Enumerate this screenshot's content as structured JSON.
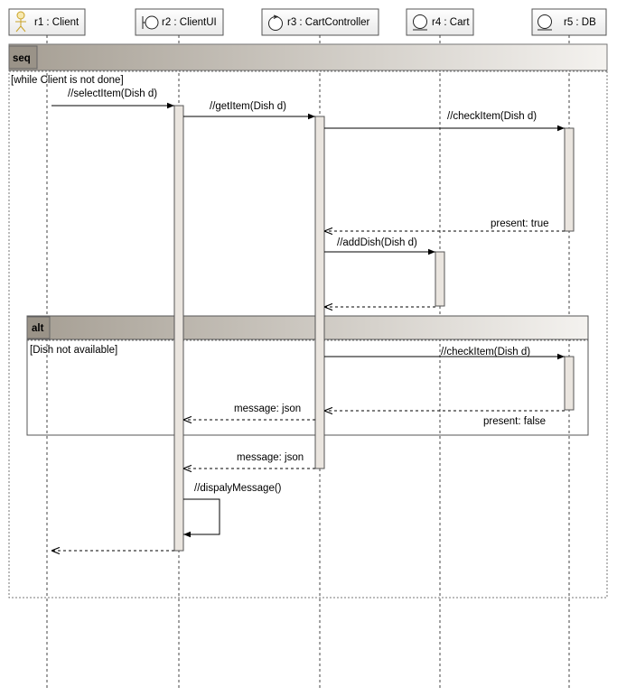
{
  "participants": [
    {
      "label": "r1 : Client",
      "icon": "actor-icon"
    },
    {
      "label": "r2 : ClientUI",
      "icon": "boundary-icon"
    },
    {
      "label": "r3 : CartController",
      "icon": "control-icon"
    },
    {
      "label": "r4 : Cart",
      "icon": "entity-icon"
    },
    {
      "label": "r5 : DB",
      "icon": "entity-icon"
    }
  ],
  "fragments": {
    "seq": {
      "operator": "seq",
      "guard": "[while Client is not done]"
    },
    "alt": {
      "operator": "alt",
      "guard": "[Dish not available]"
    }
  },
  "messages": [
    {
      "label": "//selectItem(Dish d)"
    },
    {
      "label": "//getItem(Dish d)"
    },
    {
      "label": "//checkItem(Dish d)"
    },
    {
      "label": "present: true"
    },
    {
      "label": "//addDish(Dish d)"
    },
    {
      "label": "//checkItem(Dish d)"
    },
    {
      "label": "present: false"
    },
    {
      "label": "message: json"
    },
    {
      "label": "message: json"
    },
    {
      "label": "//dispalyMessage()"
    }
  ],
  "colors": {
    "header_fill": "#f2f2f2",
    "fragment_header_start": "#a59e93",
    "fragment_header_end": "#f4f2ef",
    "activation_fill": "#eae5df",
    "line": "#333333",
    "actor_accent": "#c9a227"
  }
}
